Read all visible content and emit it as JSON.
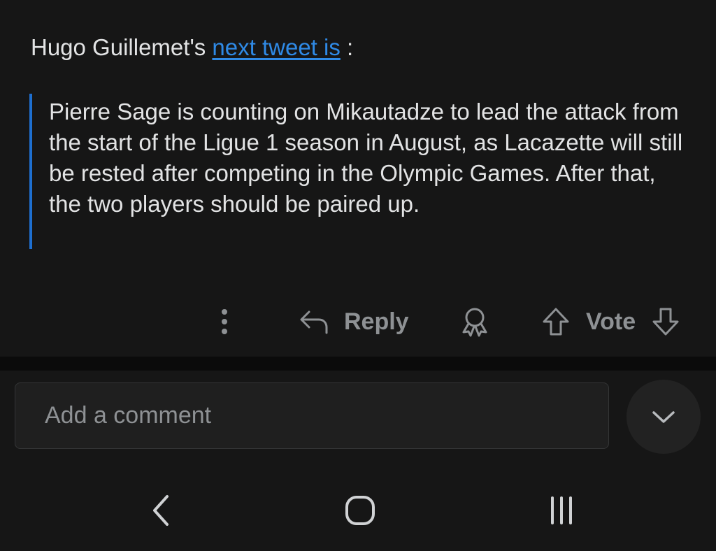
{
  "comment": {
    "author_prefix": "Hugo Guillemet's ",
    "link_text": "next tweet is",
    "suffix": " :",
    "quote": "Pierre Sage is counting on Mikautadze to lead the attack from the start of the Ligue 1 season in August, as Lacazette will still be rested after competing in the Olympic Games. After that, the two players should be paired up."
  },
  "actions": {
    "more_icon": "vertical-ellipsis-icon",
    "reply_label": "Reply",
    "award_icon": "award-icon",
    "vote_label": "Vote"
  },
  "composer": {
    "placeholder": "Add a comment"
  },
  "colors": {
    "background": "#161616",
    "link": "#2f8ae6",
    "quote_bar": "#1e6fd0",
    "muted": "#8e9194"
  }
}
